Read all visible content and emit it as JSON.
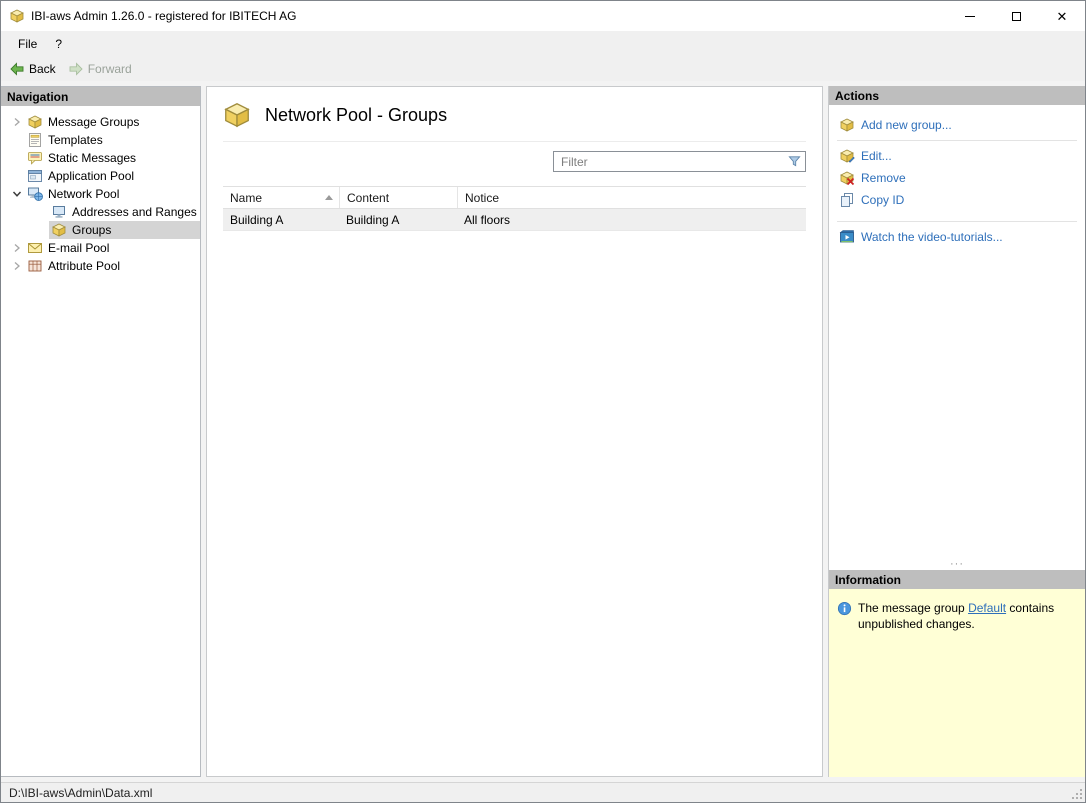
{
  "window": {
    "title": "IBI-aws Admin 1.26.0 - registered for IBITECH AG",
    "controls": [
      "minimize-button",
      "maximize-button",
      "close-button"
    ]
  },
  "menu": {
    "file_label": "File",
    "help_label": "?"
  },
  "toolbar": {
    "back_label": "Back",
    "forward_label": "Forward",
    "back_icon": "back-arrow-icon",
    "forward_icon": "forward-arrow-icon",
    "forward_enabled": false
  },
  "navigation": {
    "header": "Navigation",
    "items": [
      {
        "label": "Message Groups",
        "icon": "message-groups-icon",
        "chevron": "right",
        "level": 1,
        "selected": false
      },
      {
        "label": "Templates",
        "icon": "templates-icon",
        "chevron": "none",
        "level": 1,
        "selected": false
      },
      {
        "label": "Static Messages",
        "icon": "static-messages-icon",
        "chevron": "none",
        "level": 1,
        "selected": false
      },
      {
        "label": "Application Pool",
        "icon": "application-pool-icon",
        "chevron": "none",
        "level": 1,
        "selected": false
      },
      {
        "label": "Network Pool",
        "icon": "network-pool-icon",
        "chevron": "down",
        "level": 1,
        "selected": false
      },
      {
        "label": "Addresses and Ranges",
        "icon": "addresses-icon",
        "chevron": "none",
        "level": 2,
        "selected": false
      },
      {
        "label": "Groups",
        "icon": "groups-icon",
        "chevron": "none",
        "level": 2,
        "selected": true
      },
      {
        "label": "E-mail Pool",
        "icon": "email-pool-icon",
        "chevron": "right",
        "level": 1,
        "selected": false
      },
      {
        "label": "Attribute Pool",
        "icon": "attribute-pool-icon",
        "chevron": "right",
        "level": 1,
        "selected": false
      }
    ]
  },
  "content": {
    "title": "Network Pool - Groups",
    "title_icon": "group-box-icon",
    "filter_placeholder": "Filter",
    "filter_icon": "filter-funnel-icon",
    "table": {
      "columns": [
        "Name",
        "Content",
        "Notice"
      ],
      "sort": {
        "column": "Name",
        "direction": "asc"
      },
      "rows": [
        {
          "name": "Building A",
          "content": "Building A",
          "notice": "All floors"
        }
      ]
    }
  },
  "actions": {
    "header": "Actions",
    "items": [
      {
        "label": "Add new group...",
        "icon": "add-group-icon"
      },
      {
        "label": "Edit...",
        "icon": "edit-group-icon"
      },
      {
        "label": "Remove",
        "icon": "remove-group-icon"
      },
      {
        "label": "Copy ID",
        "icon": "copy-id-icon"
      },
      {
        "label": "Watch the video-tutorials...",
        "icon": "video-tutorials-icon"
      }
    ]
  },
  "information": {
    "header": "Information",
    "icon": "info-icon",
    "text_before": "The message group ",
    "link_label": "Default",
    "text_after": " contains unpublished changes."
  },
  "statusbar": {
    "path": "D:\\IBI-aws\\Admin\\Data.xml"
  },
  "colors": {
    "link_blue": "#2e6fba",
    "panel_header_gray": "#bebebe",
    "info_background": "#ffffd6",
    "selection_gray": "#d4d4d4",
    "row_highlight": "#efefef"
  }
}
